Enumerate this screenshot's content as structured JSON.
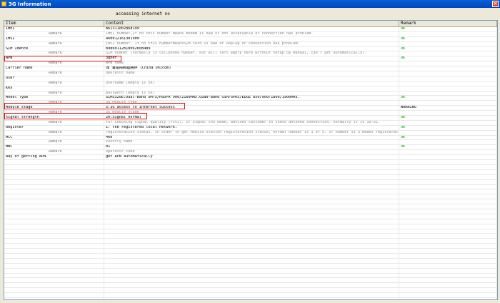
{
  "window": {
    "title": "3G Information"
  },
  "status_text": "accessing internet no",
  "columns": [
    "Item",
    "Content",
    "Remark"
  ],
  "rows": [
    {
      "item": "IMEI",
      "content": "861311002868199",
      "remark": "OK",
      "type": "main"
    },
    {
      "item": "Remark",
      "content": "IMEI number,If no this number means modem is bad or not accessable or connection has problem.",
      "remark": "",
      "type": "remark"
    },
    {
      "item": "IMSI",
      "content": "460012161301900",
      "remark": "OK",
      "type": "main"
    },
    {
      "item": "Remark",
      "content": "IMSI number. If no this numbermeansSIM card is bad or unplug or connection has problem.",
      "remark": "",
      "type": "remark"
    },
    {
      "item": "SIM Idence",
      "content": "89860112818062608489",
      "remark": "OK",
      "type": "main"
    },
    {
      "item": "Remark",
      "content": "SIM number (normally is cellphone number, but will left empty here without setup by manual, can't get automatically).",
      "remark": "",
      "type": "remark"
    },
    {
      "item": "APN",
      "content": "3gnet",
      "remark": "OK",
      "type": "main"
    },
    {
      "item": "Remark",
      "content": "APN name",
      "remark": "",
      "type": "remark"
    },
    {
      "item": "Carrier name",
      "content": "滿  浦鐵揭郵鏈勝絆 (China Unicom)",
      "remark": "",
      "type": "main"
    },
    {
      "item": "Remark",
      "content": "operator name",
      "remark": "",
      "type": "remark"
    },
    {
      "item": "User",
      "content": "",
      "remark": "",
      "type": "main"
    },
    {
      "item": "Remark",
      "content": "username (empty is ok)",
      "remark": "",
      "type": "remark"
    },
    {
      "item": "Key",
      "content": "",
      "remark": "",
      "type": "main"
    },
    {
      "item": "Remark",
      "content": "password (empty is ok)",
      "remark": "",
      "type": "remark"
    },
    {
      "item": "Model Type",
      "content": "SIM5320E:Dual-Band UMTS/HSDPA 900/2100MHz,Quad-Band GSM/GPRS/EDGE 850/900/1800/1900MHz.",
      "remark": "OK",
      "type": "main"
    },
    {
      "item": "Remark",
      "content": "3G Module type",
      "remark": "",
      "type": "remark"
    },
    {
      "item": "Module stage",
      "content": "5:3G access to internet success",
      "remark": "WARNING",
      "type": "main"
    },
    {
      "item": "Remark",
      "content": "3G module stage",
      "remark": "",
      "type": "remark"
    },
    {
      "item": "signal strength",
      "content": "20:Signal normal",
      "remark": "OK",
      "type": "main"
    },
    {
      "item": "Remark",
      "content": "for checking signal quality (rssi). if signal too weak, advices customer to check antenna connection. normally it is 10-31.",
      "remark": "",
      "type": "remark"
    },
    {
      "item": "Register",
      "content": "1: the registered local network.",
      "remark": "OK",
      "type": "main"
    },
    {
      "item": "Remark",
      "content": "registeration status, in order to get Mobile station registeration status, normal number is 1 or 5. if number is 3 means registeration is rejected.",
      "remark": "",
      "type": "remark"
    },
    {
      "item": "MCC",
      "content": "460",
      "remark": "OK",
      "type": "main"
    },
    {
      "item": "Remark",
      "content": "country name",
      "remark": "",
      "type": "remark"
    },
    {
      "item": "MNC",
      "content": "01",
      "remark": "OK",
      "type": "main"
    },
    {
      "item": "Remark",
      "content": "operator code",
      "remark": "",
      "type": "remark"
    },
    {
      "item": "way of getting APN",
      "content": "get APN automatically",
      "remark": "",
      "type": "main"
    }
  ],
  "empty_rows": 30,
  "colors": {
    "ok": "#00a000",
    "highlight": "#e01010",
    "titlebar": "#0a5fd6"
  }
}
